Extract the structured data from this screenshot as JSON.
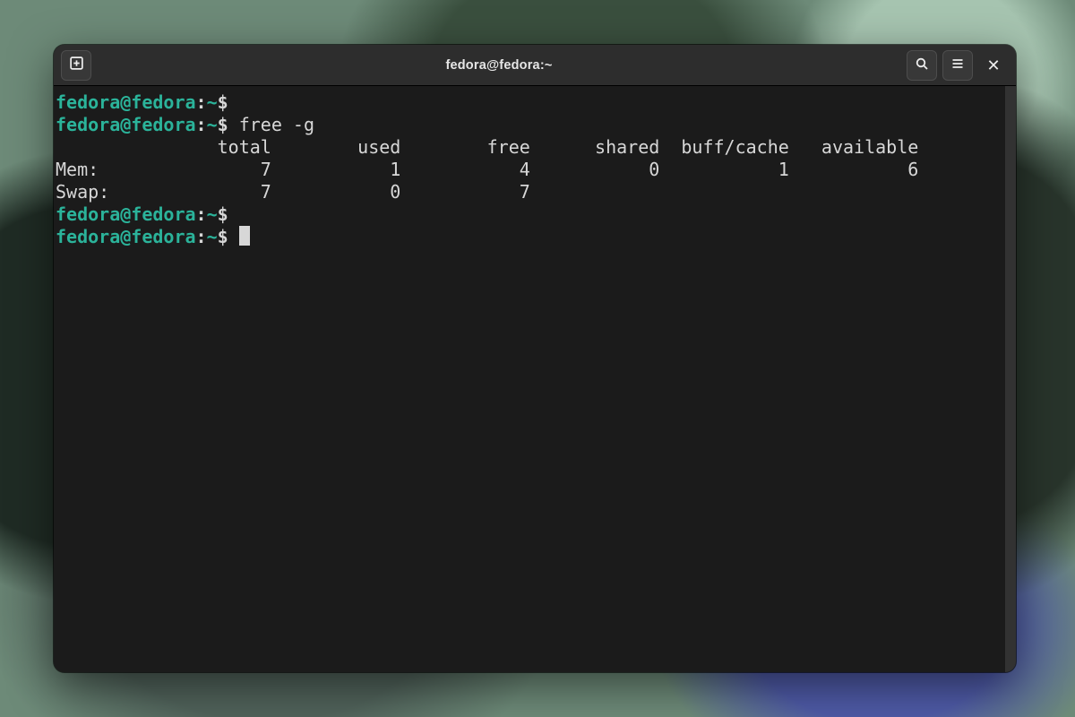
{
  "window": {
    "title": "fedora@fedora:~"
  },
  "prompt": {
    "user_host": "fedora@fedora",
    "sep": ":",
    "path": "~",
    "dollar": "$"
  },
  "terminal": {
    "lines": [
      {
        "type": "prompt",
        "cmd": ""
      },
      {
        "type": "prompt",
        "cmd": "free -g"
      },
      {
        "type": "out",
        "text": "               total        used        free      shared  buff/cache   available"
      },
      {
        "type": "out",
        "text": "Mem:               7           1           4           0           1           6"
      },
      {
        "type": "out",
        "text": "Swap:              7           0           7"
      },
      {
        "type": "prompt",
        "cmd": ""
      },
      {
        "type": "prompt",
        "cmd": "",
        "cursor": true
      }
    ]
  },
  "free_output": {
    "unit": "GiB (-g)",
    "columns": [
      "total",
      "used",
      "free",
      "shared",
      "buff/cache",
      "available"
    ],
    "rows": [
      {
        "label": "Mem",
        "values": [
          7,
          1,
          4,
          0,
          1,
          6
        ]
      },
      {
        "label": "Swap",
        "values": [
          7,
          0,
          7
        ]
      }
    ]
  }
}
